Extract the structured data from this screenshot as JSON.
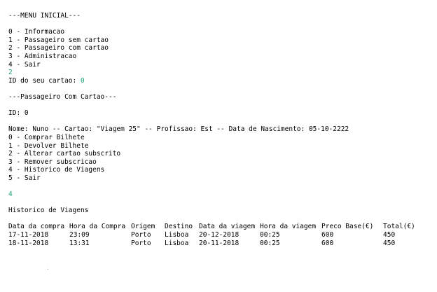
{
  "menu_inicial": {
    "header": "---MENU INICIAL---",
    "options": [
      "0 - Informacao",
      "1 - Passageiro sem cartao",
      "2 - Passageiro com cartao",
      "3 - Administracao",
      "4 - Sair"
    ],
    "user_input": "2"
  },
  "card_prompt": {
    "label": "ID do seu cartao: ",
    "value": "0"
  },
  "passageiro_com_cartao": {
    "header": "---Passageiro Com Cartao---",
    "id_line": "ID: 0",
    "details_line": "Nome: Nuno -- Cartao: \"Viagem 25\" -- Profissao: Est -- Data de Nascimento: 05-10-2222",
    "options": [
      "0 - Comprar Bilhete",
      "1 - Devolver Bilhete",
      "2 - Alterar cartao subscrito",
      "3 - Remover subscricao",
      "4 - Historico de Viagens",
      "5 - Sair"
    ],
    "user_input": "4"
  },
  "historico": {
    "title": "Historico de Viagens",
    "columns": [
      "Data da compra",
      "Hora da Compra",
      "Origem",
      "Destino",
      "Data da viagem",
      "Hora da viagem",
      "Preco Base(€)",
      "Total(€)"
    ],
    "rows": [
      [
        "17-11-2018",
        "23:09",
        "Porto",
        "Lisboa",
        "20-12-2018",
        "00:25",
        "600",
        "450"
      ],
      [
        "18-11-2018",
        "13:31",
        "Porto",
        "Lisboa",
        "20-11-2018",
        "00:25",
        "600",
        "450"
      ]
    ]
  },
  "colors": {
    "background": "#ffffff",
    "text": "#000000",
    "user_input": "#1aa36d"
  }
}
